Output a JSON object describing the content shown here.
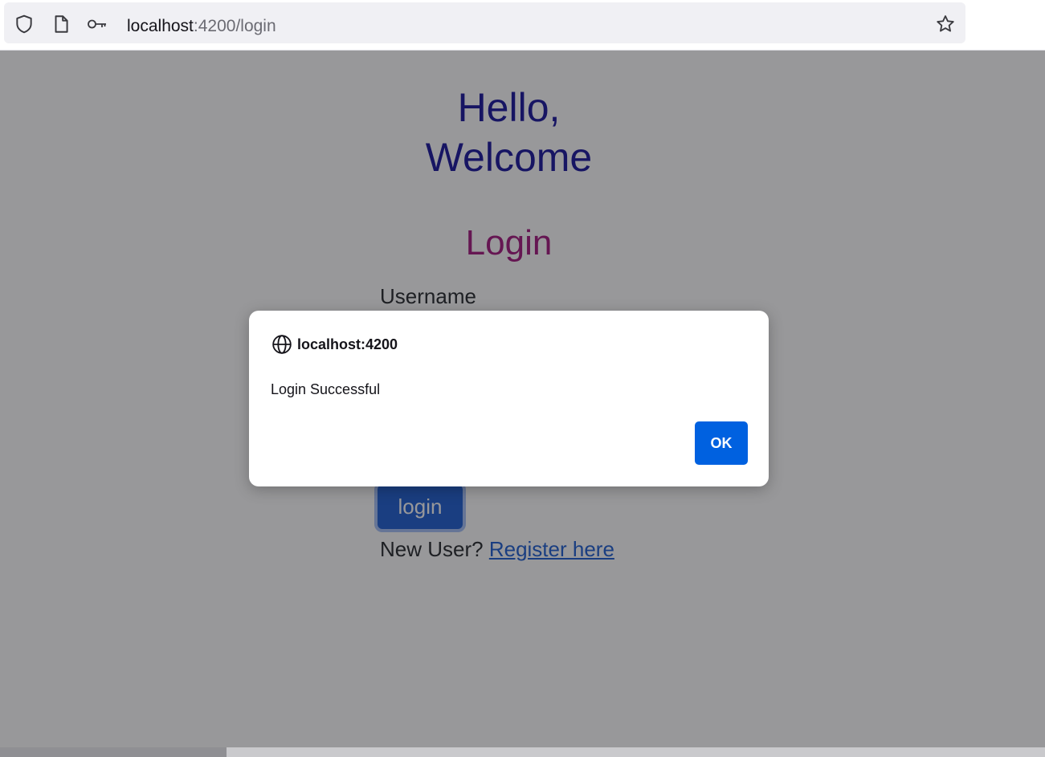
{
  "browser": {
    "url_host": "localhost",
    "url_path": ":4200/login"
  },
  "page": {
    "greeting_line1": "Hello,",
    "greeting_line2": "Welcome",
    "form_title": "Login",
    "username_label": "Username",
    "login_button": "login",
    "new_user_text": "New User?",
    "register_link": "Register here"
  },
  "dialog": {
    "origin": "localhost:4200",
    "message": "Login Successful",
    "ok_button": "OK"
  },
  "colors": {
    "greeting": "#14129c",
    "form_title": "#a3137c",
    "primary_button": "#1a5cd1",
    "dialog_ok": "#0061e0"
  },
  "icons": [
    "shield-icon",
    "page-icon",
    "key-icon",
    "star-icon",
    "globe-icon"
  ]
}
